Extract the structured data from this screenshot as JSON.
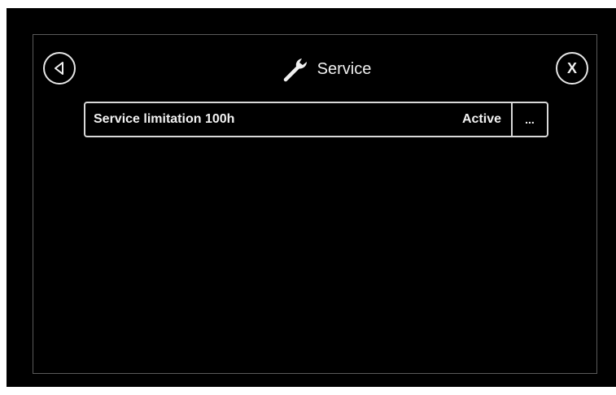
{
  "header": {
    "title": "Service",
    "title_icon": "wrench-icon",
    "back_icon": "back-arrow-icon",
    "close_label": "X"
  },
  "service_list": [
    {
      "label": "Service limitation 100h",
      "status": "Active",
      "more_label": "..."
    }
  ],
  "colors": {
    "background": "#000000",
    "foreground": "#f0f0f0",
    "border": "#d9d9d9",
    "panel_border": "#5a5a5a"
  }
}
